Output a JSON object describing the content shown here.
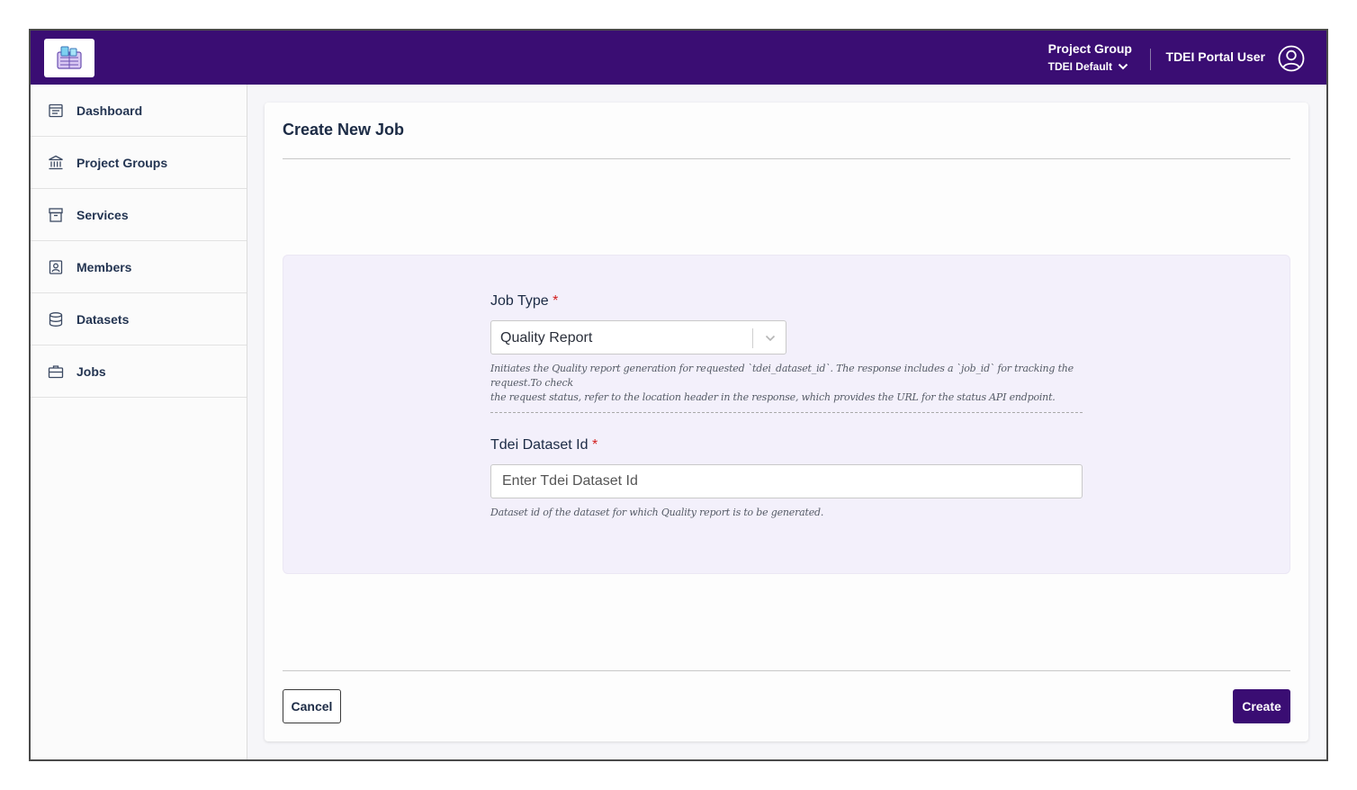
{
  "header": {
    "logo_icon": "tdei-logo-icon",
    "project_group_title": "Project Group",
    "project_group_value": "TDEI Default",
    "user_name": "TDEI Portal User",
    "brand_color": "#3a0d73"
  },
  "sidebar": {
    "items": [
      {
        "label": "Dashboard",
        "icon": "dashboard-icon"
      },
      {
        "label": "Project Groups",
        "icon": "bank-icon"
      },
      {
        "label": "Services",
        "icon": "archive-icon"
      },
      {
        "label": "Members",
        "icon": "user-badge-icon"
      },
      {
        "label": "Datasets",
        "icon": "database-icon"
      },
      {
        "label": "Jobs",
        "icon": "briefcase-icon"
      }
    ]
  },
  "main": {
    "title": "Create New Job",
    "job_type": {
      "label": "Job Type",
      "required_mark": "*",
      "value": "Quality Report",
      "help_line1": "Initiates the Quality report generation for requested `tdei_dataset_id`. The response includes a `job_id` for tracking the request.To check",
      "help_line2": "the request status, refer to the location header in the response, which provides the URL for the status API endpoint."
    },
    "dataset_id": {
      "label": "Tdei Dataset Id",
      "required_mark": "*",
      "placeholder": "Enter Tdei Dataset Id",
      "value": "",
      "help": "Dataset id of the dataset for which Quality report is to be generated."
    },
    "cancel_label": "Cancel",
    "create_label": "Create"
  }
}
